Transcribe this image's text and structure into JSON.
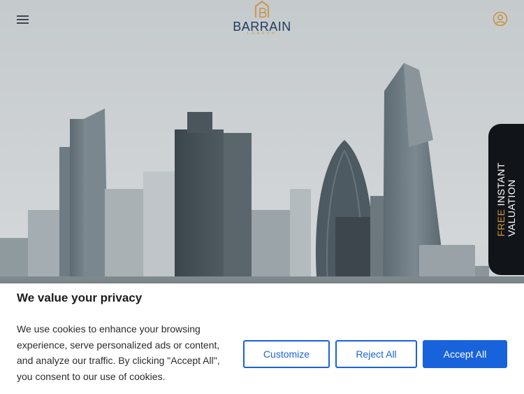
{
  "header": {
    "logo_text": "BARRAIN",
    "logo_subtext": "LONDON"
  },
  "side_tab": {
    "free": "FREE",
    "line1": "INSTANT",
    "line2": "VALUATION"
  },
  "cookie_banner": {
    "title": "We value your privacy",
    "body": "We use cookies to enhance your browsing experience, serve personalized ads or content, and analyze our traffic. By clicking \"Accept All\", you consent to our use of cookies.",
    "customize_label": "Customize",
    "reject_label": "Reject All",
    "accept_label": "Accept All"
  },
  "colors": {
    "brand_navy": "#1f3a5c",
    "brand_gold": "#c9923e",
    "cookie_accent": "#1863dc",
    "tab_background": "#111418"
  },
  "icons": [
    "hamburger-menu-icon",
    "user-account-icon",
    "logo-house-icon"
  ]
}
